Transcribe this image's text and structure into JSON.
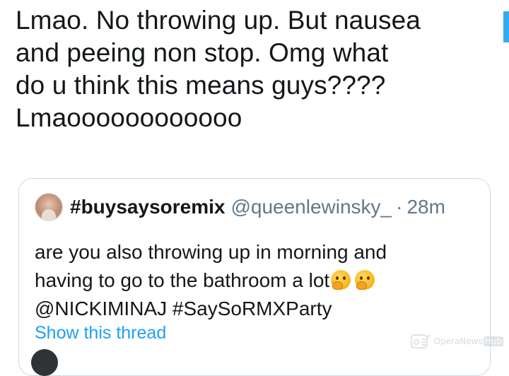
{
  "main_tweet": {
    "lines": [
      "Lmao. No throwing up. But nausea",
      "and peeing non stop. Omg what",
      "do u think this means guys????",
      "Lmaoooooooooooo"
    ]
  },
  "quoted_tweet": {
    "display_name": "#buysaysoremix",
    "handle": "@queenlewinsky_",
    "separator": "·",
    "time": "28m",
    "body_lines": [
      "are you also throwing up in morning and",
      "having to go to the bathroom a lot",
      "@NICKIMINAJ #SaySoRMXParty"
    ],
    "emojis": [
      "thinking-face-emoji",
      "thinking-face-emoji"
    ],
    "show_thread_label": "Show this thread"
  },
  "watermark": {
    "text": "OperaNews",
    "badge": "Hub"
  },
  "colors": {
    "link": "#1da1f2",
    "muted": "#657786",
    "text": "#14171a",
    "border": "#cfd9de"
  }
}
